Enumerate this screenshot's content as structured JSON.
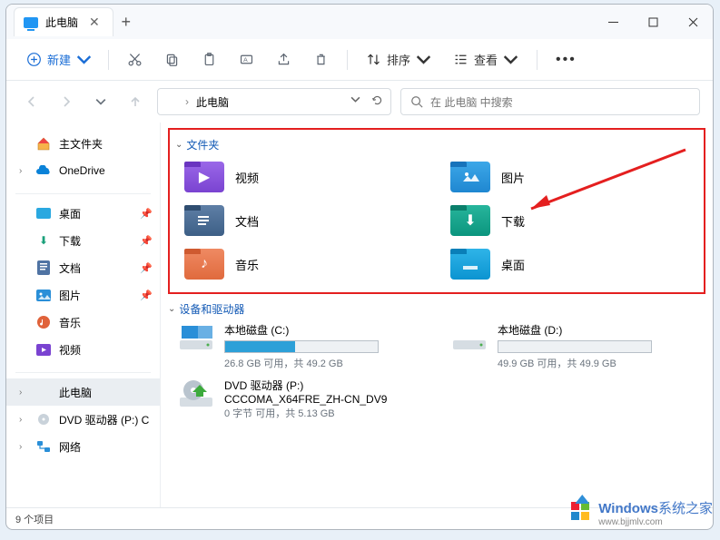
{
  "window": {
    "tab_title": "此电脑"
  },
  "toolbar": {
    "new_label": "新建",
    "sort_label": "排序",
    "view_label": "查看"
  },
  "address": {
    "location": "此电脑"
  },
  "search": {
    "placeholder": "在 此电脑 中搜索"
  },
  "sidebar": {
    "home": "主文件夹",
    "onedrive": "OneDrive",
    "quick": {
      "desktop": "桌面",
      "downloads": "下载",
      "documents": "文档",
      "pictures": "图片",
      "music": "音乐",
      "videos": "视频"
    },
    "this_pc": "此电脑",
    "dvd": "DVD 驱动器 (P:) C",
    "network": "网络"
  },
  "sections": {
    "folders": "文件夹",
    "devices": "设备和驱动器"
  },
  "folders": {
    "videos": "视频",
    "pictures": "图片",
    "documents": "文档",
    "downloads": "下载",
    "music": "音乐",
    "desktop": "桌面"
  },
  "drives": [
    {
      "name": "本地磁盘 (C:)",
      "sub": "26.8 GB 可用，共 49.2 GB",
      "fill_pct": 46
    },
    {
      "name": "本地磁盘 (D:)",
      "sub": "49.9 GB 可用，共 49.9 GB",
      "fill_pct": 0
    },
    {
      "name": "DVD 驱动器 (P:)",
      "line2": "CCCOMA_X64FRE_ZH-CN_DV9",
      "sub": "0 字节 可用，共 5.13 GB"
    }
  ],
  "status": {
    "items": "9 个项目"
  },
  "watermark": {
    "brand": "Windows",
    "suffix": "系统之家",
    "url": "www.bjjmlv.com"
  }
}
